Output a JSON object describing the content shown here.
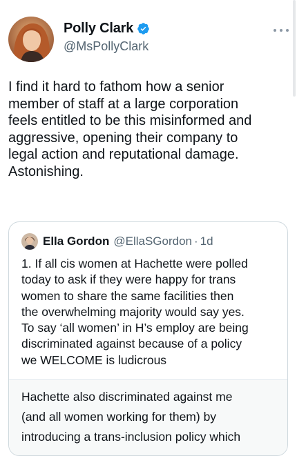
{
  "author": {
    "display_name": "Polly Clark",
    "handle": "@MsPollyClark",
    "verified": true,
    "avatar_icon": "profile-photo",
    "verified_icon": "verified-badge-icon",
    "verified_color": "#1d9bf0"
  },
  "tweet": {
    "text": "I find it hard to fathom how a senior\nmember of staff at a large corporation\nfeels entitled to be this misinformed and\naggressive, opening their company to\nlegal action and reputational damage.\nAstonishing."
  },
  "more_menu_icon": "more-horizontal-icon",
  "quoted": {
    "display_name": "Ella Gordon",
    "handle": "@EllaSGordon",
    "separator": "·",
    "time": "1d",
    "text": "1. If all cis women at Hachette were polled\ntoday to ask if they were happy for trans\nwomen to share the same facilities then\nthe overwhelming majority would say yes.\nTo say ‘all women’ in H’s employ are being\ndiscriminated against because of a policy\nwe WELCOME is ludicrous",
    "nested_text": "Hachette also discriminated against me\n(and all women working for them) by\nintroducing a trans-inclusion policy which"
  },
  "colors": {
    "text_primary": "#0f1419",
    "text_secondary": "#536471",
    "border": "#cfd9de",
    "nested_background": "#f7f9f9"
  }
}
